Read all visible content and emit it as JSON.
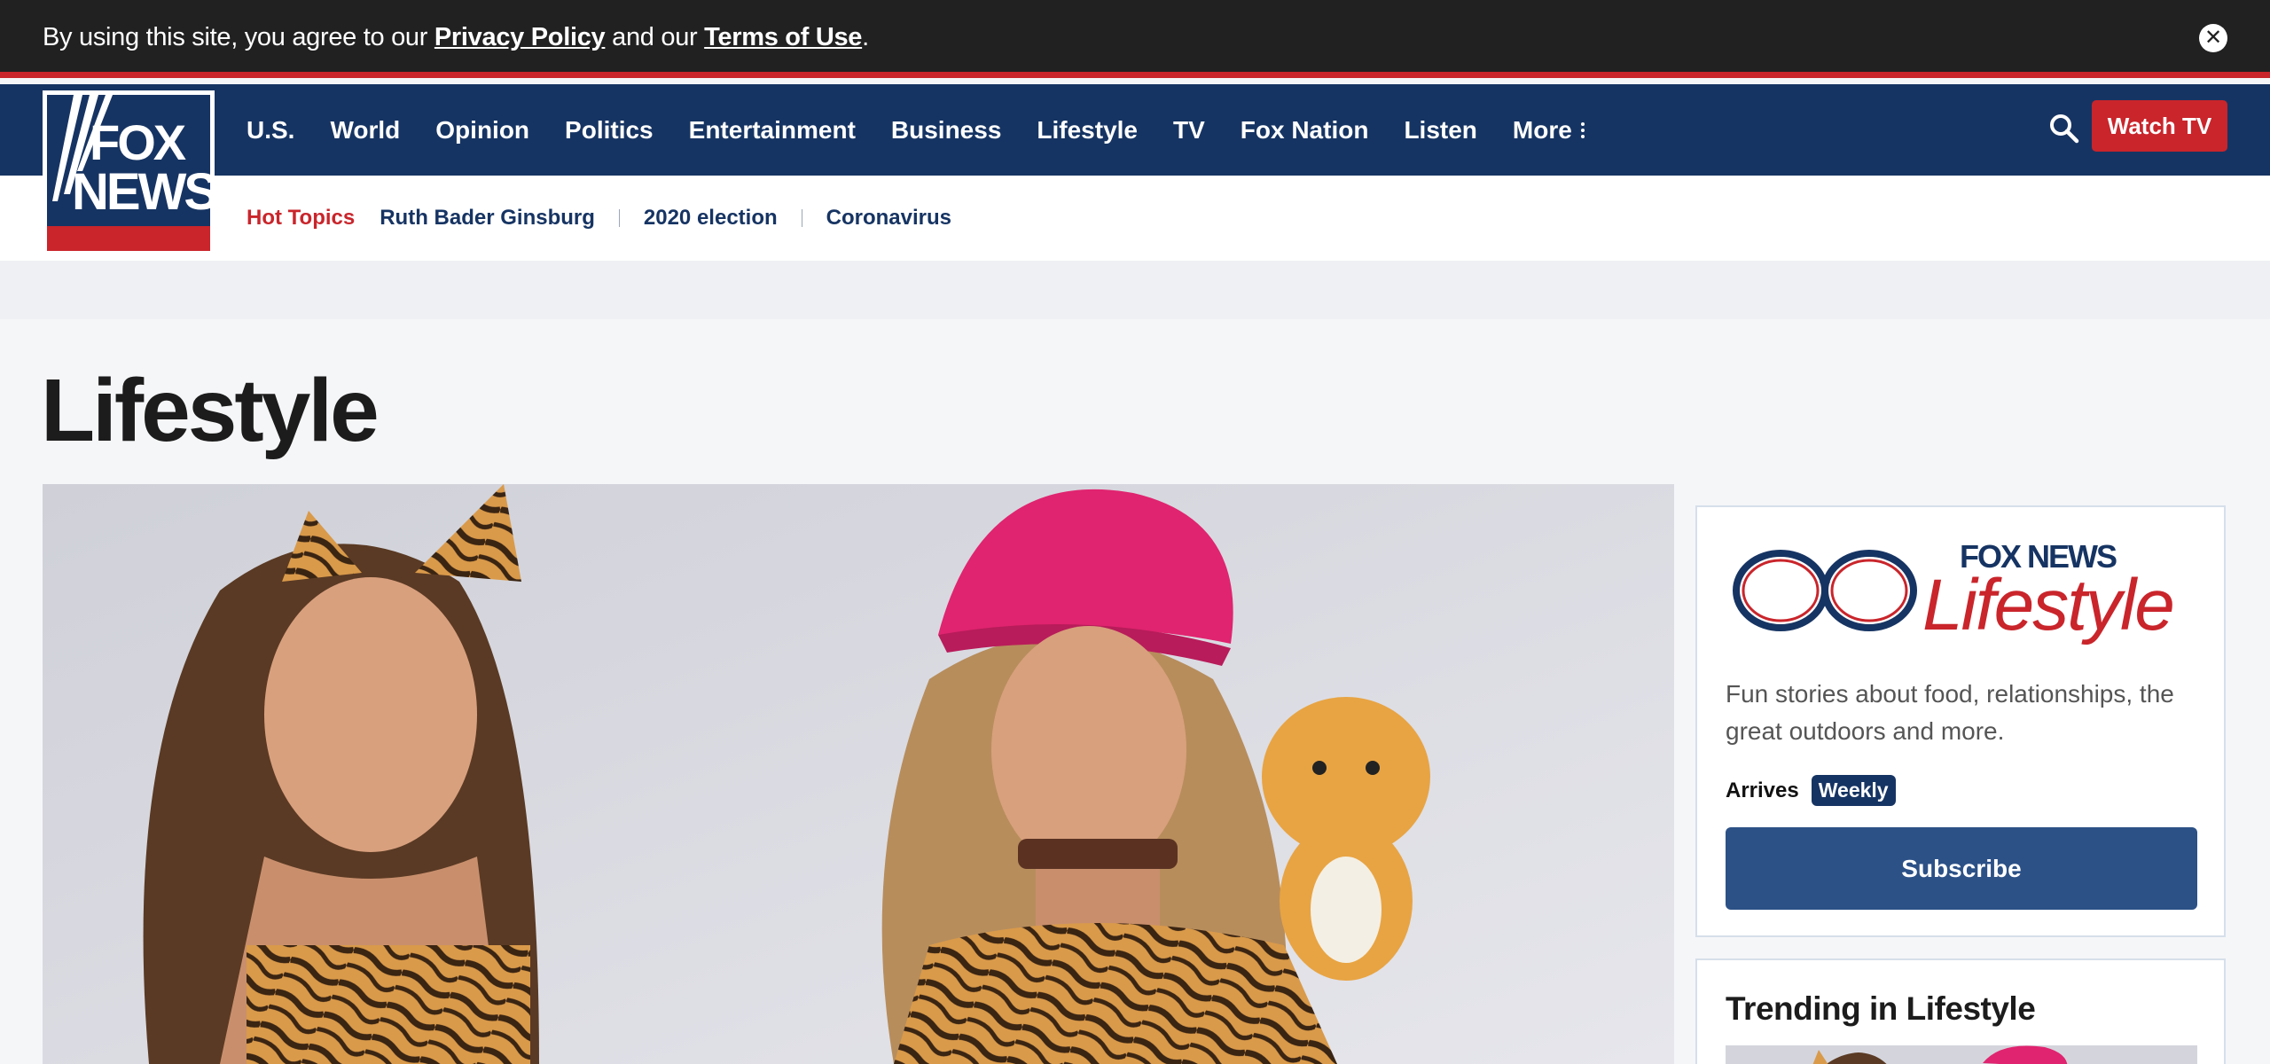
{
  "cookie_banner": {
    "text_before": "By using this site, you agree to our ",
    "privacy_link": "Privacy Policy",
    "text_middle": " and our ",
    "terms_link": "Terms of Use",
    "text_after": ".",
    "close_icon": "close-circle-icon"
  },
  "brand": {
    "logo_line1": "FOX",
    "logo_line2": "NEWS",
    "colors": {
      "navy": "#163463",
      "red": "#c9252b",
      "button_blue": "#2c5187"
    }
  },
  "nav": {
    "items": [
      "U.S.",
      "World",
      "Opinion",
      "Politics",
      "Entertainment",
      "Business",
      "Lifestyle",
      "TV",
      "Fox Nation",
      "Listen",
      "More"
    ],
    "search_icon": "search-icon",
    "watch_tv_label": "Watch TV"
  },
  "hot_topics": {
    "label": "Hot Topics",
    "items": [
      "Ruth Bader Ginsburg",
      "2020 election",
      "Coronavirus"
    ]
  },
  "page": {
    "title": "Lifestyle"
  },
  "newsletter": {
    "brand_top": "FOX NEWS",
    "brand_bottom": "Lifestyle",
    "description": "Fun stories about food, relationships, the great outdoors and more.",
    "arrives_label": "Arrives",
    "frequency": "Weekly",
    "subscribe_label": "Subscribe"
  },
  "trending": {
    "title": "Trending in Lifestyle"
  }
}
